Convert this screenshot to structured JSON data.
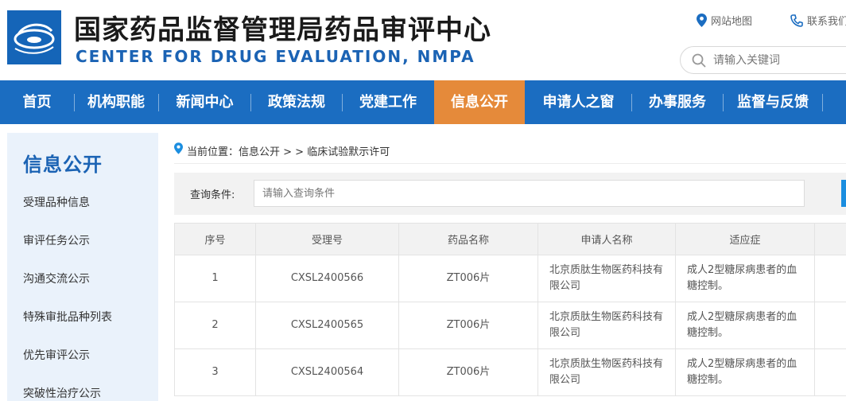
{
  "header": {
    "title_cn": "国家药品监督管理局药品审评中心",
    "title_en": "CENTER FOR DRUG EVALUATION, NMPA",
    "sitemap_label": "网站地图",
    "contact_label": "联系我们",
    "search_placeholder": "请输入关键词"
  },
  "nav": {
    "items": [
      "首页",
      "机构职能",
      "新闻中心",
      "政策法规",
      "党建工作",
      "信息公开",
      "申请人之窗",
      "办事服务",
      "监督与反馈"
    ],
    "active": "信息公开"
  },
  "sidebar": {
    "title": "信息公开",
    "items": [
      "受理品种信息",
      "审评任务公示",
      "沟通交流公示",
      "特殊审批品种列表",
      "优先审评公示",
      "突破性治疗公示"
    ]
  },
  "breadcrumb": {
    "prefix": "当前位置：",
    "text": "信息公开 > > 临床试验默示许可"
  },
  "query": {
    "label": "查询条件:",
    "placeholder": "请输入查询条件"
  },
  "table": {
    "headers": [
      "序号",
      "受理号",
      "药品名称",
      "申请人名称",
      "适应症",
      ""
    ],
    "rows": [
      [
        "1",
        "CXSL2400566",
        "ZT006片",
        "北京质肽生物医药科技有限公司",
        "成人2型糖尿病患者的血糖控制。",
        ""
      ],
      [
        "2",
        "CXSL2400565",
        "ZT006片",
        "北京质肽生物医药科技有限公司",
        "成人2型糖尿病患者的血糖控制。",
        ""
      ],
      [
        "3",
        "CXSL2400564",
        "ZT006片",
        "北京质肽生物医药科技有限公司",
        "成人2型糖尿病患者的血糖控制。",
        ""
      ]
    ]
  },
  "colors": {
    "primary_blue": "#1b6dc1",
    "active_orange": "#e58a3a",
    "sidebar_bg": "#eaf2fb"
  }
}
